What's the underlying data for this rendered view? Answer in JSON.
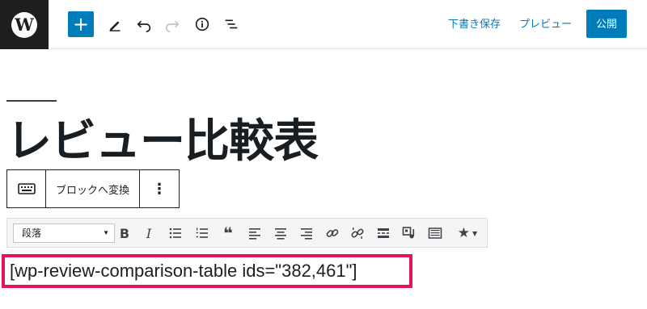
{
  "topbar": {
    "logo_letter": "W",
    "save_draft_label": "下書き保存",
    "preview_label": "プレビュー",
    "publish_label": "公開",
    "accent_color": "#007cba"
  },
  "post": {
    "title": "レビュー比較表"
  },
  "block_toolbar": {
    "transform_label": "ブロックへ変換",
    "more_label": "⋮"
  },
  "classic_toolbar": {
    "format_select_value": "段落",
    "icons": [
      "bold-icon",
      "italic-icon",
      "bullet-list-icon",
      "numbered-list-icon",
      "blockquote-icon",
      "align-left-icon",
      "align-center-icon",
      "align-right-icon",
      "link-icon",
      "unlink-icon",
      "more-tag-icon",
      "media-icon",
      "toolbar-toggle-icon",
      "star-icon"
    ],
    "bold_label": "B",
    "italic_label": "I"
  },
  "content": {
    "shortcode": "[wp-review-comparison-table ids=\"382,461\"]",
    "highlight_color": "#e3115e"
  }
}
